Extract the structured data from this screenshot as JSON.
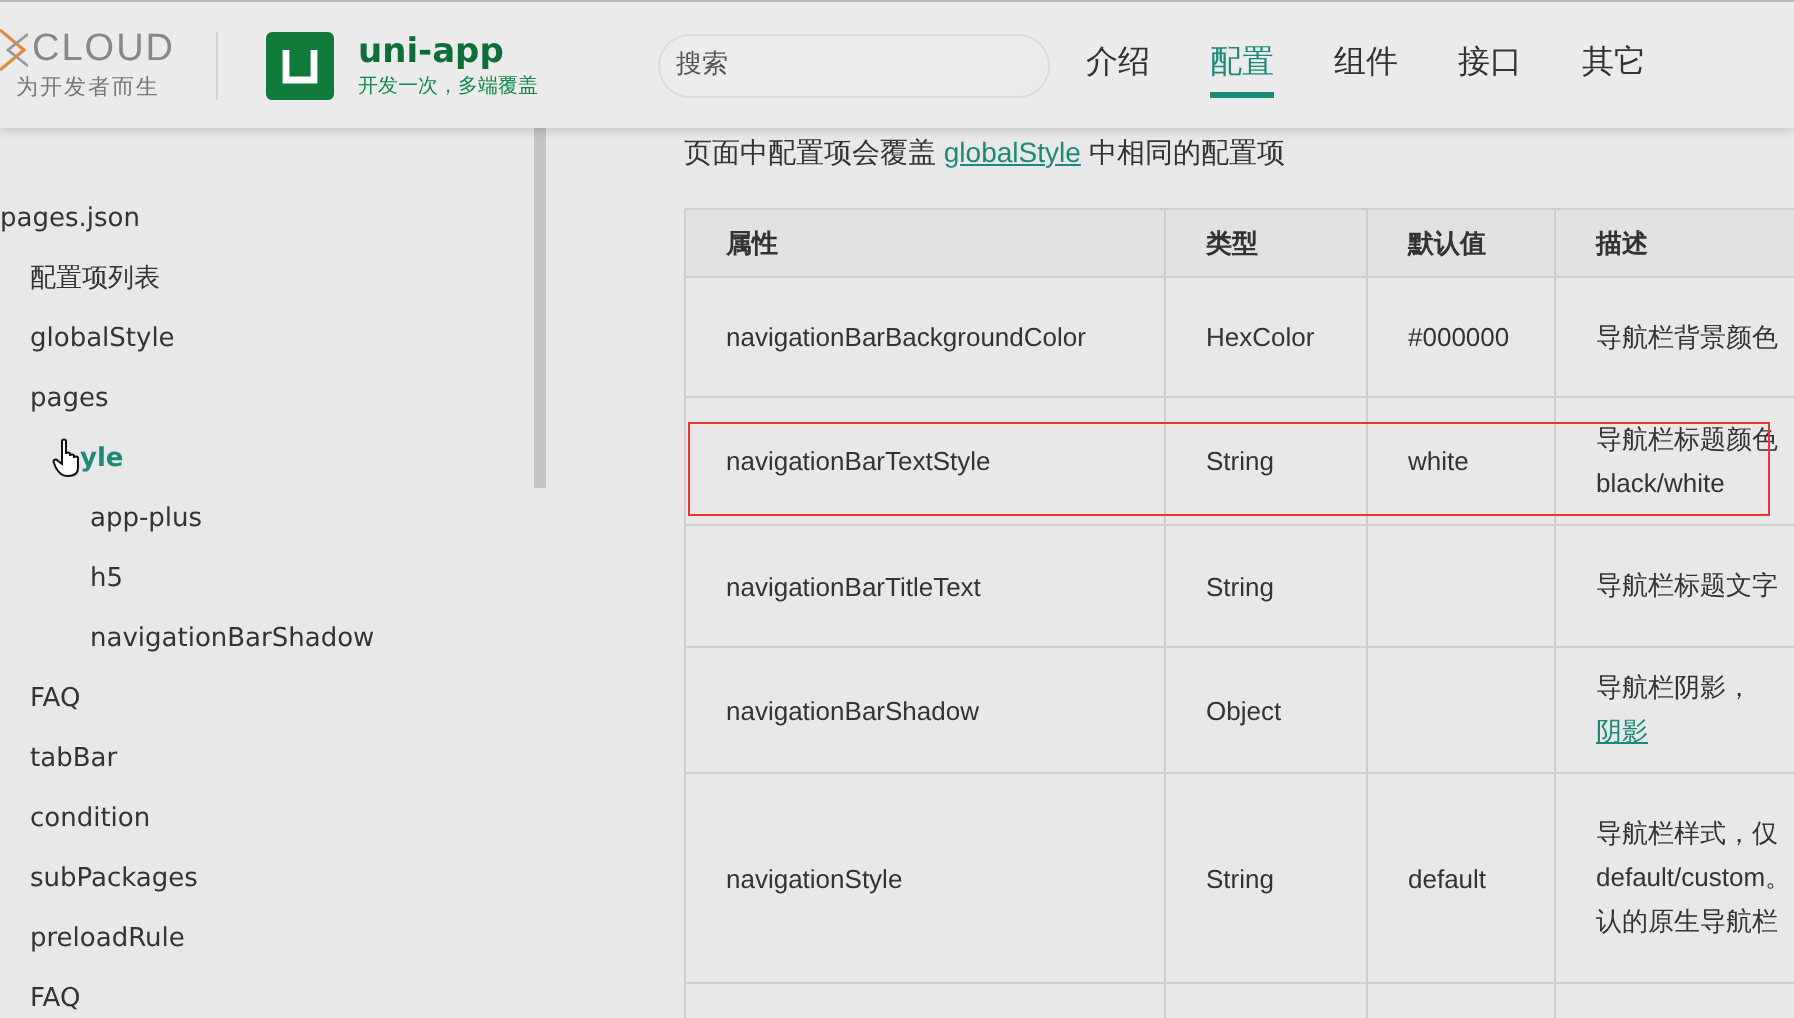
{
  "header": {
    "brand": {
      "logo": "CLOUD",
      "slogan": "为开发者而生"
    },
    "product": {
      "name": "uni-app",
      "tagline": "开发一次，多端覆盖"
    },
    "search": {
      "placeholder": "搜索"
    },
    "nav": [
      {
        "label": "介绍",
        "selected": false
      },
      {
        "label": "配置",
        "selected": true
      },
      {
        "label": "组件",
        "selected": false
      },
      {
        "label": "接口",
        "selected": false
      },
      {
        "label": "其它",
        "selected": false
      }
    ]
  },
  "sidebar": {
    "items": [
      {
        "label": "pages.json",
        "selected": false,
        "children": [
          {
            "label": "配置项列表",
            "selected": false
          },
          {
            "label": "globalStyle",
            "selected": false
          },
          {
            "label": "pages",
            "selected": false,
            "children": [
              {
                "label": "yle",
                "selected": true,
                "children": [
                  {
                    "label": "app-plus",
                    "selected": false
                  },
                  {
                    "label": "h5",
                    "selected": false
                  },
                  {
                    "label": "navigationBarShadow",
                    "selected": false
                  }
                ]
              }
            ]
          },
          {
            "label": "FAQ",
            "selected": false
          },
          {
            "label": "tabBar",
            "selected": false
          },
          {
            "label": "condition",
            "selected": false
          },
          {
            "label": "subPackages",
            "selected": false
          },
          {
            "label": "preloadRule",
            "selected": false
          },
          {
            "label": "FAQ",
            "selected": false
          }
        ]
      }
    ]
  },
  "content": {
    "intro": {
      "before": "页面中配置项会覆盖 ",
      "link": "globalStyle",
      "after": " 中相同的配置项"
    },
    "table": {
      "columns": [
        "属性",
        "类型",
        "默认值",
        "描述"
      ],
      "rows": [
        {
          "cells": [
            "navigationBarBackgroundColor",
            "HexColor",
            "#000000"
          ],
          "description": [
            "导航栏背景颜色"
          ],
          "highlighted": false
        },
        {
          "cells": [
            "navigationBarTextStyle",
            "String",
            "white"
          ],
          "description": [
            "导航栏标题颜色",
            "black/white"
          ],
          "highlighted": true
        },
        {
          "cells": [
            "navigationBarTitleText",
            "String",
            ""
          ],
          "description": [
            "导航栏标题文字"
          ],
          "highlighted": false
        },
        {
          "cells": [
            "navigationBarShadow",
            "Object",
            ""
          ],
          "description": [
            "导航栏阴影，"
          ],
          "link": "阴影",
          "highlighted": false
        },
        {
          "cells": [
            "navigationStyle",
            "String",
            "default"
          ],
          "description": [
            "导航栏样式，仅",
            "default/custom。",
            "认的原生导航栏"
          ],
          "highlighted": false
        }
      ]
    }
  }
}
